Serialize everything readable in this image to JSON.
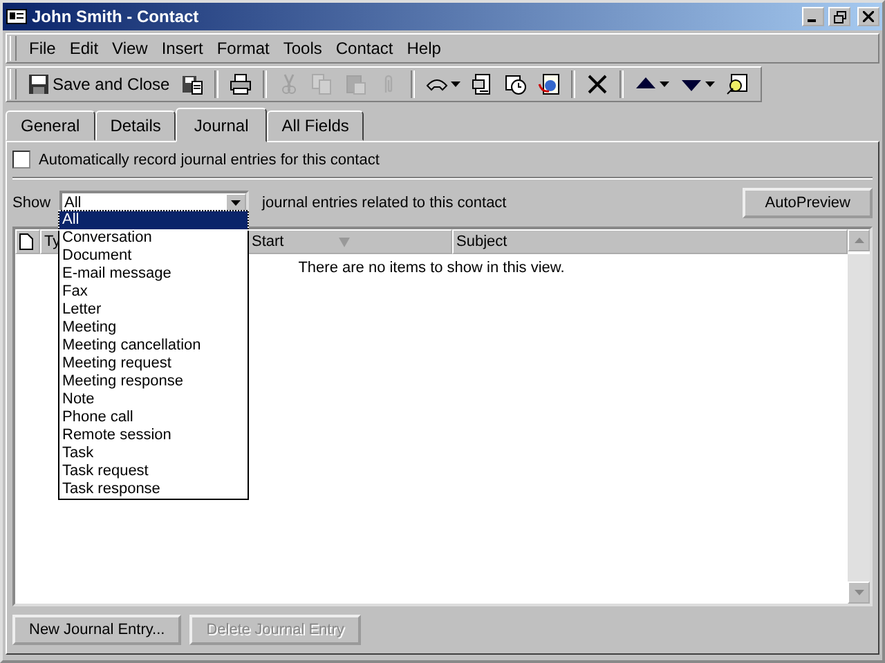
{
  "window": {
    "title": "John Smith - Contact"
  },
  "menu": [
    "File",
    "Edit",
    "View",
    "Insert",
    "Format",
    "Tools",
    "Contact",
    "Help"
  ],
  "toolbar": {
    "save_and_close": "Save and Close",
    "buttons": [
      {
        "kind": "button",
        "disabled": false,
        "dropdown": false
      },
      {
        "kind": "separator"
      },
      {
        "kind": "button",
        "disabled": false,
        "dropdown": false
      },
      {
        "kind": "separator"
      },
      {
        "kind": "button",
        "disabled": true,
        "dropdown": false
      },
      {
        "kind": "button",
        "disabled": true,
        "dropdown": false
      },
      {
        "kind": "button",
        "disabled": true,
        "dropdown": false
      },
      {
        "kind": "button",
        "disabled": true,
        "dropdown": false
      },
      {
        "kind": "separator"
      },
      {
        "kind": "button",
        "disabled": false,
        "dropdown": true
      },
      {
        "kind": "button",
        "disabled": false,
        "dropdown": false
      },
      {
        "kind": "button",
        "disabled": false,
        "dropdown": false
      },
      {
        "kind": "button",
        "disabled": false,
        "dropdown": false
      },
      {
        "kind": "separator"
      },
      {
        "kind": "button",
        "disabled": false,
        "dropdown": false
      },
      {
        "kind": "separator"
      },
      {
        "kind": "button",
        "disabled": false,
        "dropdown": true
      },
      {
        "kind": "button",
        "disabled": false,
        "dropdown": true
      },
      {
        "kind": "button",
        "disabled": false,
        "dropdown": false
      }
    ]
  },
  "tabs": [
    {
      "label": "General",
      "selected": false
    },
    {
      "label": "Details",
      "selected": false
    },
    {
      "label": "Journal",
      "selected": true
    },
    {
      "label": "All Fields",
      "selected": false
    }
  ],
  "auto_record": {
    "label": "Automatically record journal entries for this contact",
    "checked": false
  },
  "show": {
    "label": "Show",
    "value": "All",
    "suffix": "journal entries related to this contact",
    "autopreview": "AutoPreview",
    "options": [
      {
        "label": "All",
        "selected": true
      },
      {
        "label": "Conversation",
        "selected": false
      },
      {
        "label": "Document",
        "selected": false
      },
      {
        "label": "E-mail message",
        "selected": false
      },
      {
        "label": "Fax",
        "selected": false
      },
      {
        "label": "Letter",
        "selected": false
      },
      {
        "label": "Meeting",
        "selected": false
      },
      {
        "label": "Meeting cancellation",
        "selected": false
      },
      {
        "label": "Meeting request",
        "selected": false
      },
      {
        "label": "Meeting response",
        "selected": false
      },
      {
        "label": "Note",
        "selected": false
      },
      {
        "label": "Phone call",
        "selected": false
      },
      {
        "label": "Remote session",
        "selected": false
      },
      {
        "label": "Task",
        "selected": false
      },
      {
        "label": "Task request",
        "selected": false
      },
      {
        "label": "Task response",
        "selected": false
      }
    ]
  },
  "table": {
    "columns": [
      "Ty",
      "Start",
      "Subject"
    ],
    "empty_message": "There are no items to show in this view."
  },
  "buttons": [
    {
      "label": "New Journal Entry...",
      "disabled": false
    },
    {
      "label": "Delete Journal Entry",
      "disabled": true
    }
  ]
}
